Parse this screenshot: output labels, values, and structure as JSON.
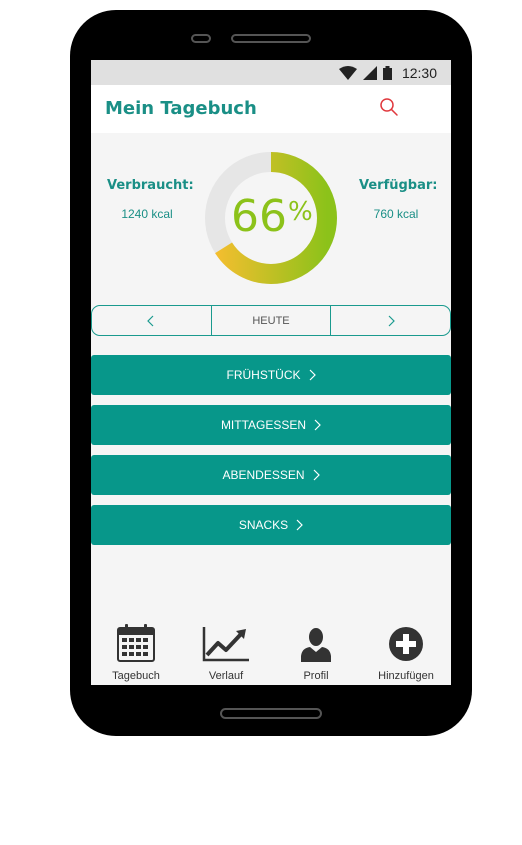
{
  "status_bar": {
    "time": "12:30",
    "icons": [
      "wifi-icon",
      "signal-icon",
      "battery-icon"
    ]
  },
  "header": {
    "title": "Mein Tagebuch",
    "search_icon": "search-icon"
  },
  "summary": {
    "consumed_label": "Verbraucht:",
    "consumed_value": "1240 kcal",
    "available_label": "Verfügbar:",
    "available_value": "760 kcal",
    "percent_number": "66",
    "percent_sign": "%",
    "percent_fraction": 0.66
  },
  "date_nav": {
    "label": "HEUTE",
    "prev_icon": "chevron-left-icon",
    "next_icon": "chevron-right-icon"
  },
  "meals": [
    {
      "label": "FRÜHSTÜCK"
    },
    {
      "label": "MITTAGESSEN"
    },
    {
      "label": "ABENDESSEN"
    },
    {
      "label": "SNACKS"
    }
  ],
  "tabs": [
    {
      "label": "Tagebuch",
      "icon": "calendar-icon"
    },
    {
      "label": "Verlauf",
      "icon": "line-chart-icon"
    },
    {
      "label": "Profil",
      "icon": "user-icon"
    },
    {
      "label": "Hinzufügen",
      "icon": "plus-circle-icon"
    }
  ],
  "colors": {
    "accent": "#1a8f86",
    "button": "#07978a",
    "ring_start": "#f5be2f",
    "ring_end": "#8cc21a",
    "ring_track": "#e6e6e6",
    "search": "#e0393e"
  }
}
